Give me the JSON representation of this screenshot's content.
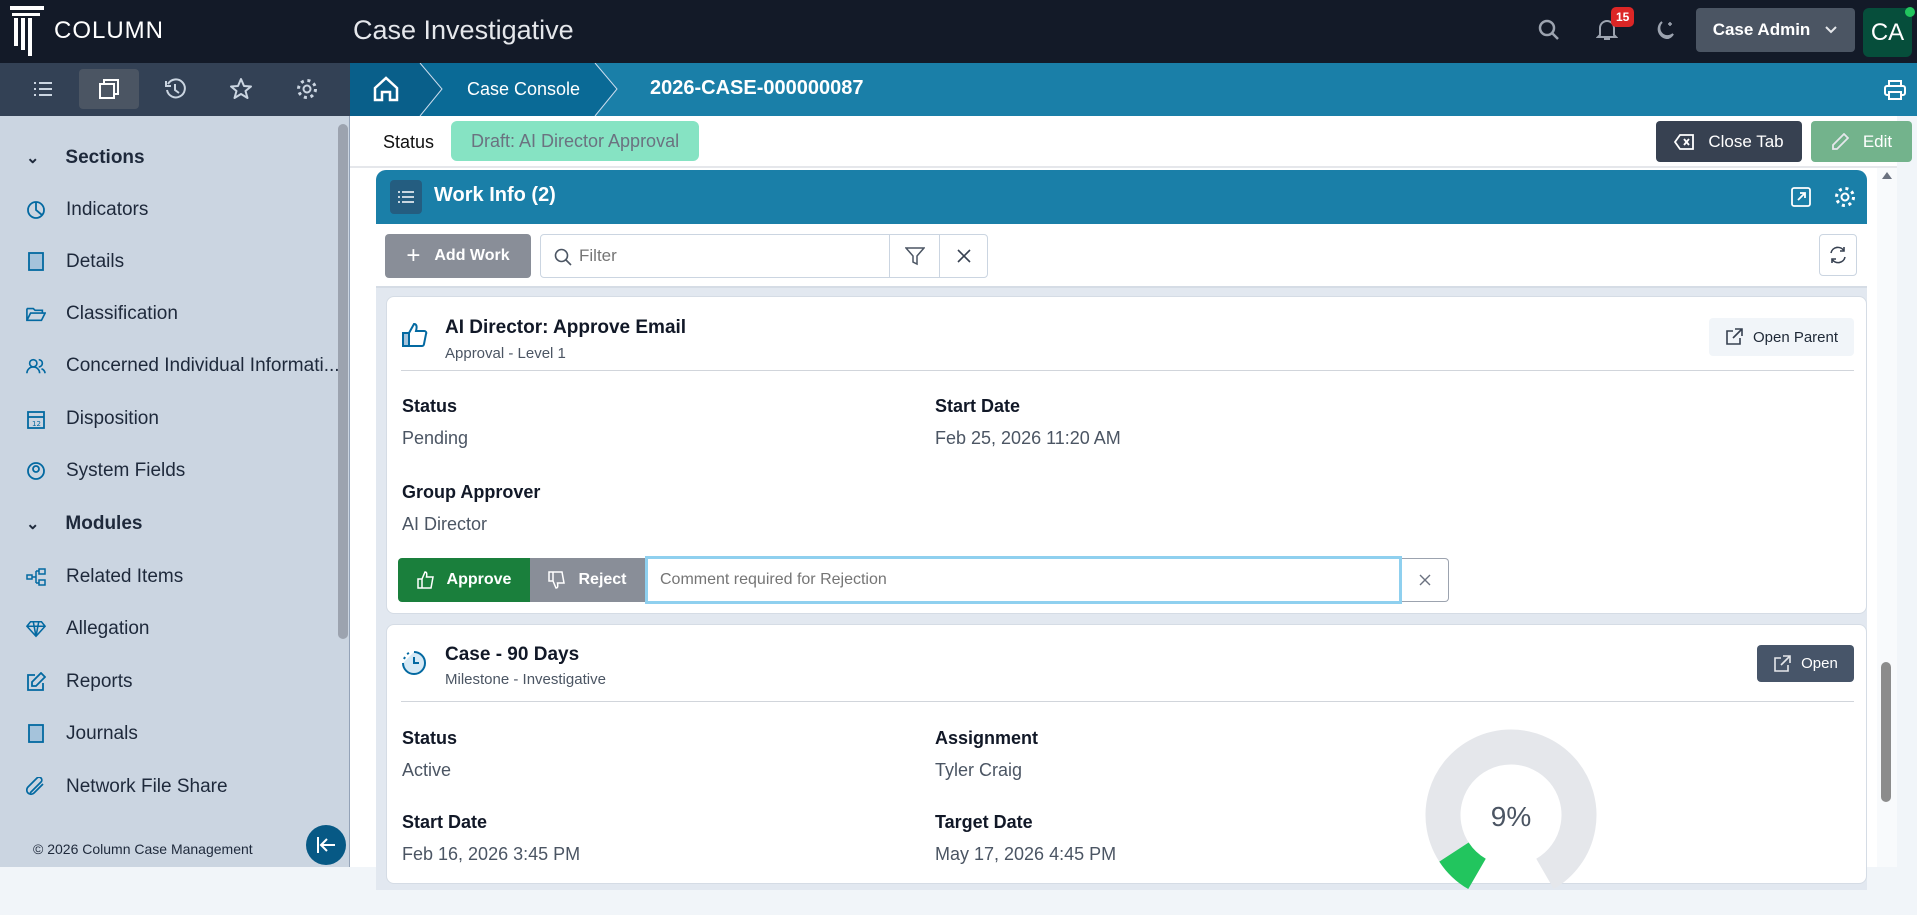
{
  "header": {
    "logo_text": "COLUMN",
    "app_title": "Case Investigative",
    "notification_count": "15",
    "user_menu_label": "Case Admin",
    "avatar_initials": "CA"
  },
  "breadcrumb": {
    "items": [
      "Case Console",
      "2026-CASE-000000087"
    ]
  },
  "status_bar": {
    "label": "Status",
    "value": "Draft: AI Director Approval",
    "close_tab_label": "Close Tab",
    "edit_label": "Edit"
  },
  "sidebar": {
    "sections_label": "Sections",
    "sections": [
      "Indicators",
      "Details",
      "Classification",
      "Concerned Individual Informati...",
      "Disposition",
      "System Fields"
    ],
    "modules_label": "Modules",
    "modules": [
      "Related Items",
      "Allegation",
      "Reports",
      "Journals",
      "Network File Share"
    ],
    "footer": "© 2026 Column Case Management"
  },
  "work_info": {
    "title": "Work Info (2)",
    "add_work_label": "Add Work",
    "filter_placeholder": "Filter",
    "items": [
      {
        "title": "AI Director: Approve Email",
        "subtitle": "Approval - Level 1",
        "open_label": "Open Parent",
        "fields": [
          {
            "label": "Status",
            "value": "Pending"
          },
          {
            "label": "Start Date",
            "value": "Feb 25, 2026 11:20 AM"
          },
          {
            "label": "Group Approver",
            "value": "AI Director"
          }
        ],
        "approve_label": "Approve",
        "reject_label": "Reject",
        "comment_placeholder": "Comment required for Rejection"
      },
      {
        "title": "Case - 90 Days",
        "subtitle": "Milestone - Investigative",
        "open_label": "Open",
        "fields": [
          {
            "label": "Status",
            "value": "Active"
          },
          {
            "label": "Assignment",
            "value": "Tyler Craig"
          },
          {
            "label": "Start Date",
            "value": "Feb 16, 2026 3:45 PM"
          },
          {
            "label": "Target Date",
            "value": "May 17, 2026 4:45 PM"
          }
        ],
        "progress_percent": 9,
        "progress_label": "9%"
      }
    ]
  },
  "colors": {
    "brand_blue": "#1a7fa8",
    "approve_green": "#1a7f3c",
    "progress_green": "#22c55e",
    "status_badge": "#86e3c3"
  }
}
